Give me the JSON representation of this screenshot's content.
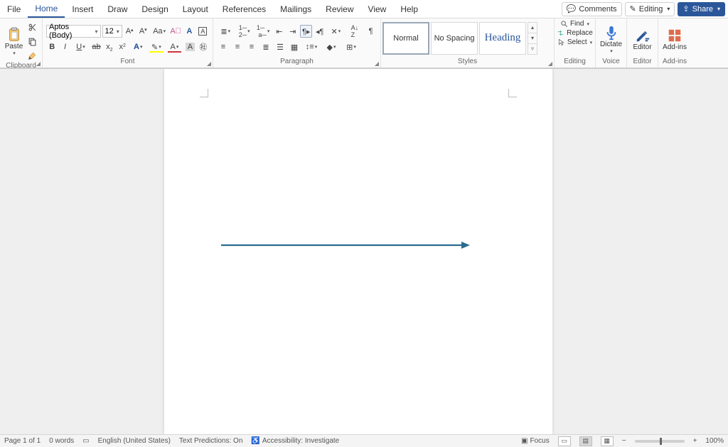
{
  "tabs": {
    "items": [
      "File",
      "Home",
      "Insert",
      "Draw",
      "Design",
      "Layout",
      "References",
      "Mailings",
      "Review",
      "View",
      "Help"
    ],
    "active": "Home"
  },
  "titlebar": {
    "comments": "Comments",
    "editing": "Editing",
    "share": "Share"
  },
  "ribbon": {
    "clipboard": {
      "label": "Clipboard",
      "paste": "Paste"
    },
    "font": {
      "label": "Font",
      "name": "Aptos (Body)",
      "size": "12"
    },
    "paragraph": {
      "label": "Paragraph"
    },
    "styles": {
      "label": "Styles",
      "items": [
        {
          "name": "Normal",
          "active": true
        },
        {
          "name": "No Spacing",
          "active": false
        },
        {
          "name": "Heading 1",
          "display": "Heading",
          "active": false
        }
      ]
    },
    "editing": {
      "label": "Editing",
      "find": "Find",
      "replace": "Replace",
      "select": "Select"
    },
    "voice": {
      "label": "Voice",
      "dictate": "Dictate"
    },
    "editor": {
      "label": "Editor",
      "btn": "Editor"
    },
    "addins": {
      "label": "Add-ins",
      "btn": "Add-ins"
    }
  },
  "status": {
    "page": "Page 1 of 1",
    "words": "0 words",
    "language": "English (United States)",
    "predictions": "Text Predictions: On",
    "accessibility": "Accessibility: Investigate",
    "focus": "Focus",
    "zoom": "100%"
  },
  "shape": {
    "type": "arrow",
    "color": "#2b6c8f"
  }
}
